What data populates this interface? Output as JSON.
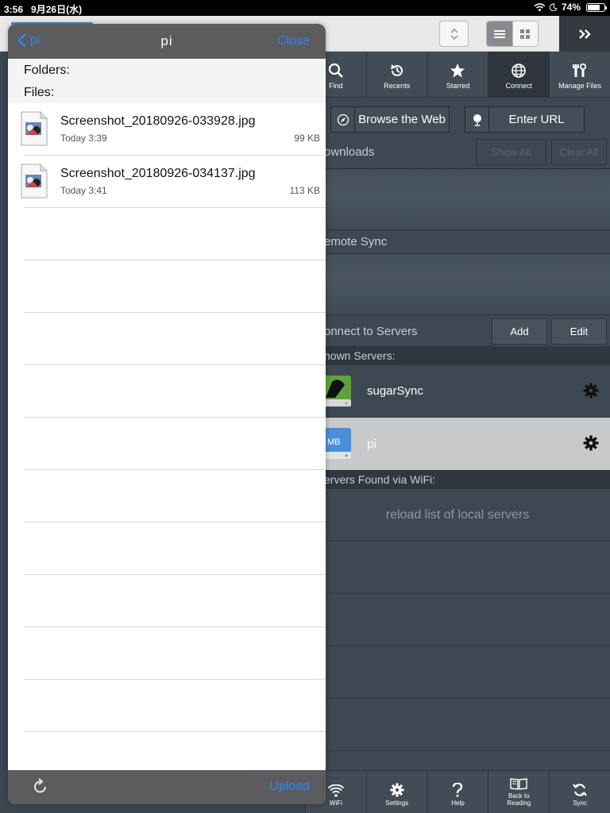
{
  "status_bar": {
    "time": "3:56",
    "date": "9月26日(水)",
    "battery": "74%",
    "battery_level": 0.74
  },
  "toolbar": {
    "chevron_label": "»"
  },
  "tabs": [
    {
      "label": "Find",
      "icon": "search-icon"
    },
    {
      "label": "Recents",
      "icon": "recents-icon"
    },
    {
      "label": "Starred",
      "icon": "star-icon"
    },
    {
      "label": "Connect",
      "icon": "globe-icon",
      "active": true
    },
    {
      "label": "Manage Files",
      "icon": "tools-icon"
    }
  ],
  "right": {
    "browse_web": "Browse the Web",
    "enter_url": "Enter URL",
    "downloads_head": "ownloads",
    "show_all": "Show All",
    "clear_all": "Clear All",
    "remote_sync_head": "emote Sync",
    "connect_head": "onnect to Servers",
    "add": "Add",
    "edit": "Edit",
    "known_servers_head": "nown Servers:",
    "servers": [
      {
        "name": "sugarSync",
        "icon": "sugarsync-drive-icon"
      },
      {
        "name": "pi",
        "icon": "smb-drive-icon",
        "badge": "MB",
        "selected": true
      }
    ],
    "wifi_head": "ervers Found via WiFi:",
    "reload": "reload list of local servers"
  },
  "bottom_tabs": [
    {
      "label": "WiFi",
      "icon": "wifi-icon"
    },
    {
      "label": "Settings",
      "icon": "gear-icon"
    },
    {
      "label": "Help",
      "icon": "question-icon"
    },
    {
      "label": "Back to Reading",
      "icon": "book-icon"
    },
    {
      "label": "Sync",
      "icon": "sync-icon"
    }
  ],
  "popover": {
    "back_label": "pi",
    "title": "pi",
    "close_label": "Close",
    "folders_label": "Folders:",
    "files_label": "Files:",
    "files": [
      {
        "name": "Screenshot_20180926-033928.jpg",
        "date": "Today 3:39",
        "size": "99 KB"
      },
      {
        "name": "Screenshot_20180926-034137.jpg",
        "date": "Today 3:41",
        "size": "113 KB"
      }
    ],
    "upload_label": "Upload"
  },
  "colors": {
    "accent": "#2d86f0",
    "nav": "#5c5c5f",
    "panel": "#3e4852"
  }
}
